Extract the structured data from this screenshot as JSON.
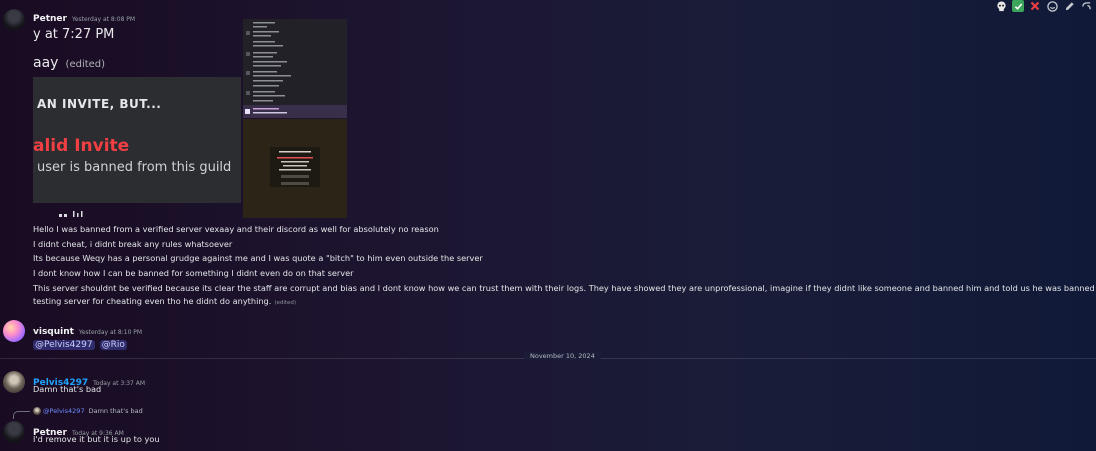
{
  "toolbar": {
    "icons": [
      "skull-icon",
      "check-icon",
      "cross-icon",
      "emoji-icon",
      "edit-icon",
      "reply-icon"
    ]
  },
  "messages": {
    "petner1": {
      "username": "Petner",
      "timestamp": "Yesterday at 8:08 PM",
      "screenshot_left": {
        "line1": "y at 7:27 PM",
        "line2": "aay",
        "line2_edited": "(edited)",
        "heading": "AN INVITE, BUT...",
        "invalid": "alid Invite",
        "banned": "user is banned from this guild"
      },
      "lines": [
        "Hello I was banned from a verified server vexaay and their discord as well for absolutely no reason",
        "I didnt cheat, i didnt break any rules whatsoever",
        "Its because Weqy has a personal grudge against me and I was quote a \"bitch\" to him even outside the server",
        "I dont know how I can be banned for something I didnt even do on that server",
        "This server shouldnt be verified because its clear the staff are corrupt and bias and I dont know how we can trust them with their logs. They have showed they are unprofessional, imagine if they didnt like someone and banned him and told us he was banned on a verified",
        "testing server for cheating even tho he didnt do anything."
      ],
      "edited": "(edited)"
    },
    "visquint": {
      "username": "visquint",
      "timestamp": "Yesterday at 8:10 PM",
      "mention1": "@Pelvis4297",
      "mention2": "@Rio"
    },
    "divider": "November 10, 2024",
    "pelvis": {
      "username": "Pelvis4297",
      "timestamp": "Today at 3:37 AM",
      "text": "Damn that's bad"
    },
    "petner2": {
      "reply_mention": "@Pelvis4297",
      "reply_text": "Damn that's bad",
      "username": "Petner",
      "timestamp": "Today at 9:36 AM",
      "text": "I'd remove it but it is up to you"
    }
  },
  "colors": {
    "pelvis_name": "#1fa3ff",
    "invalid_red": "#f23f43"
  }
}
